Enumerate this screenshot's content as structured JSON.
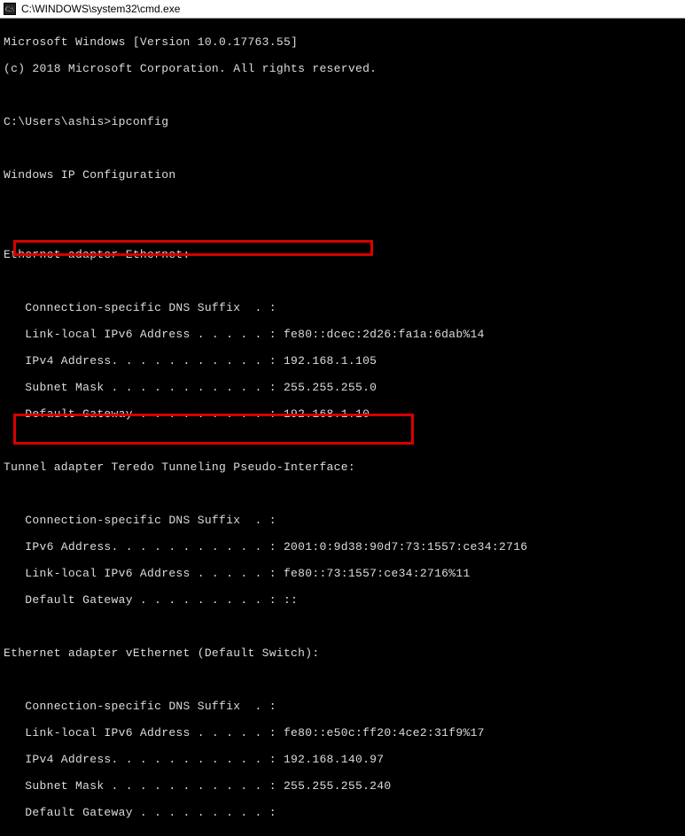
{
  "window": {
    "title": "C:\\WINDOWS\\system32\\cmd.exe"
  },
  "terminal": {
    "lines": [
      "Microsoft Windows [Version 10.0.17763.55]",
      "(c) 2018 Microsoft Corporation. All rights reserved.",
      "",
      "C:\\Users\\ashis>ipconfig",
      "",
      "Windows IP Configuration",
      "",
      "",
      "Ethernet adapter Ethernet:",
      "",
      "   Connection-specific DNS Suffix  . :",
      "   Link-local IPv6 Address . . . . . : fe80::dcec:2d26:fa1a:6dab%14",
      "   IPv4 Address. . . . . . . . . . . : 192.168.1.105",
      "   Subnet Mask . . . . . . . . . . . : 255.255.255.0",
      "   Default Gateway . . . . . . . . . : 192.168.1.10",
      "",
      "Tunnel adapter Teredo Tunneling Pseudo-Interface:",
      "",
      "   Connection-specific DNS Suffix  . :",
      "   IPv6 Address. . . . . . . . . . . : 2001:0:9d38:90d7:73:1557:ce34:2716",
      "   Link-local IPv6 Address . . . . . : fe80::73:1557:ce34:2716%11",
      "   Default Gateway . . . . . . . . . : ::",
      "",
      "Ethernet adapter vEthernet (Default Switch):",
      "",
      "   Connection-specific DNS Suffix  . :",
      "   Link-local IPv6 Address . . . . . : fe80::e50c:ff20:4ce2:31f9%17",
      "   IPv4 Address. . . . . . . . . . . : 192.168.140.97",
      "   Subnet Mask . . . . . . . . . . . : 255.255.255.240",
      "   Default Gateway . . . . . . . . . :"
    ],
    "prompt_user": "ashis",
    "command": "ipconfig",
    "windows_version": "10.0.17763.55"
  },
  "adapters": [
    {
      "name": "Ethernet adapter Ethernet",
      "dns_suffix": "",
      "link_local_ipv6": "fe80::dcec:2d26:fa1a:6dab%14",
      "ipv4": "192.168.1.105",
      "subnet_mask": "255.255.255.0",
      "default_gateway": "192.168.1.10"
    },
    {
      "name": "Tunnel adapter Teredo Tunneling Pseudo-Interface",
      "dns_suffix": "",
      "ipv6": "2001:0:9d38:90d7:73:1557:ce34:2716",
      "link_local_ipv6": "fe80::73:1557:ce34:2716%11",
      "default_gateway": "::"
    },
    {
      "name": "Ethernet adapter vEthernet (Default Switch)",
      "dns_suffix": "",
      "link_local_ipv6": "fe80::e50c:ff20:4ce2:31f9%17",
      "ipv4": "192.168.140.97",
      "subnet_mask": "255.255.255.240",
      "default_gateway": ""
    }
  ]
}
